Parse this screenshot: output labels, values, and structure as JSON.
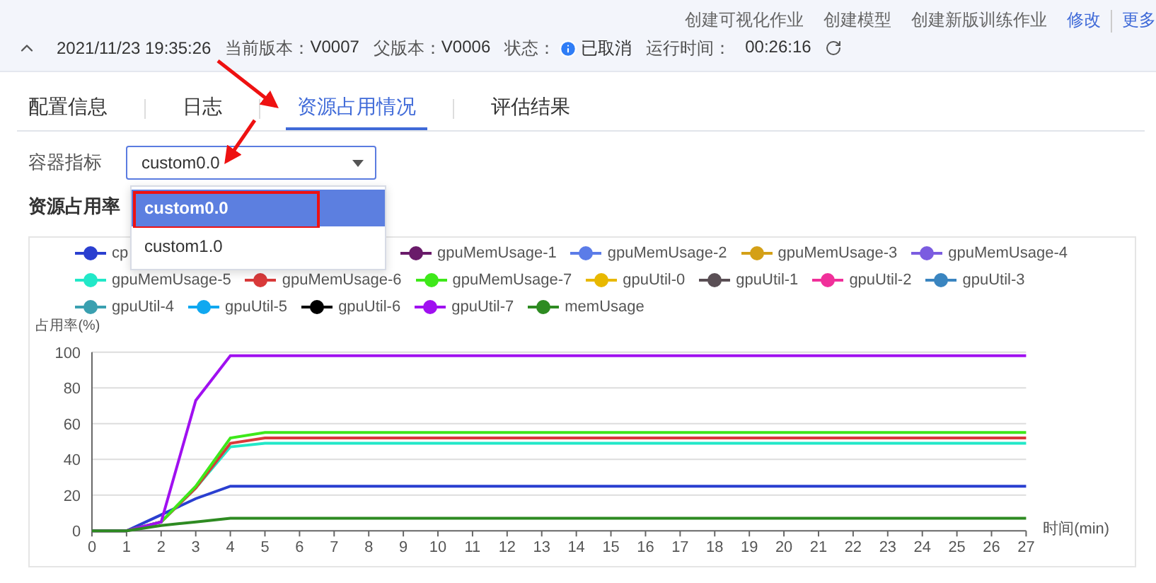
{
  "header": {
    "actions": [
      "创建可视化作业",
      "创建模型",
      "创建新版训练作业",
      "修改",
      "更多"
    ],
    "timestamp": "2021/11/23 19:35:26",
    "fields": [
      {
        "label": "当前版本：",
        "value": "V0007"
      },
      {
        "label": "父版本：",
        "value": "V0006"
      }
    ],
    "status": {
      "label": "状态：",
      "value": "已取消"
    },
    "runtime": {
      "label": "运行时间：",
      "value": "00:26:16"
    }
  },
  "tabs": [
    {
      "label": "配置信息",
      "selected": false
    },
    {
      "label": "日志",
      "selected": false
    },
    {
      "label": "资源占用情况",
      "selected": true
    },
    {
      "label": "评估结果",
      "selected": false
    }
  ],
  "metric_select": {
    "label": "容器指标",
    "value": "custom0.0",
    "expanded": true,
    "options": [
      {
        "label": "custom0.0",
        "selected": true
      },
      {
        "label": "custom1.0",
        "selected": false
      }
    ]
  },
  "section_title": "资源占用率",
  "legend": [
    [
      {
        "kind": "series"
      },
      {
        "name": "gpuMemUsage-1",
        "color": "#6a1b6a"
      },
      {
        "name": "gpuMemUsage-2",
        "color": "#5b7ce8"
      },
      {
        "name": "gpuMemUsage-3",
        "color": "#d4a017"
      },
      {
        "name": "gpuMemUsage-4",
        "color": "#7b5ce0"
      }
    ],
    [
      {
        "kind": "series"
      },
      {
        "kind": "series"
      },
      {
        "kind": "series"
      },
      {
        "name": "gpuUtil-0",
        "color": "#e8b800"
      },
      {
        "name": "gpuUtil-1",
        "color": "#5a4f55"
      },
      {
        "name": "gpuUtil-2",
        "color": "#f0309a"
      },
      {
        "name": "gpuUtil-3",
        "color": "#3a85c0"
      }
    ],
    [
      {
        "name": "gpuUtil-4",
        "color": "#3aa0b0"
      },
      {
        "name": "gpuUtil-5",
        "color": "#10a8f0"
      },
      {
        "name": "gpuUtil-6",
        "color": "#000000"
      },
      {
        "kind": "series"
      },
      {
        "kind": "series"
      }
    ]
  ],
  "chart_data": {
    "type": "line",
    "grid": true,
    "xlabel": "时间(min)",
    "ylabel": "占用率(%)",
    "x": [
      0,
      1,
      2,
      3,
      4,
      5,
      6,
      7,
      8,
      9,
      10,
      11,
      12,
      13,
      14,
      15,
      16,
      17,
      18,
      19,
      20,
      21,
      22,
      23,
      24,
      25,
      26,
      27
    ],
    "xlim": [
      0,
      27
    ],
    "ylim": [
      0,
      100
    ],
    "xticks": [
      0,
      1,
      2,
      3,
      4,
      5,
      6,
      7,
      8,
      9,
      10,
      11,
      12,
      13,
      14,
      15,
      16,
      17,
      18,
      19,
      20,
      21,
      22,
      23,
      24,
      25,
      26,
      27
    ],
    "yticks": [
      0,
      20,
      40,
      60,
      80,
      100
    ],
    "series": [
      {
        "name": "cp",
        "color": "#2a3fd0",
        "values": [
          0,
          0,
          9,
          18,
          25,
          25,
          25,
          25,
          25,
          25,
          25,
          25,
          25,
          25,
          25,
          25,
          25,
          25,
          25,
          25,
          25,
          25,
          25,
          25,
          25,
          25,
          25,
          25
        ]
      },
      {
        "name": "gpuMemUsage-5",
        "color": "#22e8c8",
        "values": [
          null,
          null,
          5,
          24,
          47,
          49,
          49,
          49,
          49,
          49,
          49,
          49,
          49,
          49,
          49,
          49,
          49,
          49,
          49,
          49,
          49,
          49,
          49,
          49,
          49,
          49,
          49,
          49
        ]
      },
      {
        "name": "gpuMemUsage-6",
        "color": "#d93a3a",
        "values": [
          0,
          0,
          5,
          24,
          49,
          52,
          52,
          52,
          52,
          52,
          52,
          52,
          52,
          52,
          52,
          52,
          52,
          52,
          52,
          52,
          52,
          52,
          52,
          52,
          52,
          52,
          52,
          52
        ]
      },
      {
        "name": "gpuMemUsage-7",
        "color": "#3ee81a",
        "values": [
          0,
          0,
          5,
          25,
          52,
          55,
          55,
          55,
          55,
          55,
          55,
          55,
          55,
          55,
          55,
          55,
          55,
          55,
          55,
          55,
          55,
          55,
          55,
          55,
          55,
          55,
          55,
          55
        ]
      },
      {
        "name": "gpuUtil-7",
        "color": "#a010f0",
        "values": [
          0,
          0,
          5,
          73,
          98,
          98,
          98,
          98,
          98,
          98,
          98,
          98,
          98,
          98,
          98,
          98,
          98,
          98,
          98,
          98,
          98,
          98,
          98,
          98,
          98,
          98,
          98,
          98
        ]
      },
      {
        "name": "memUsage",
        "color": "#2e8b22",
        "values": [
          0,
          0,
          3,
          5,
          7,
          7,
          7,
          7,
          7,
          7,
          7,
          7,
          7,
          7,
          7,
          7,
          7,
          7,
          7,
          7,
          7,
          7,
          7,
          7,
          7,
          7,
          7,
          7
        ]
      }
    ]
  }
}
